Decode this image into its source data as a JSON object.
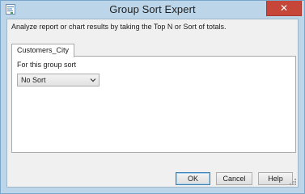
{
  "window": {
    "title": "Group Sort Expert",
    "close_symbol": "✕"
  },
  "description": "Analyze report or chart results by taking the Top N or Sort of totals.",
  "tabs": [
    {
      "label": "Customers_City",
      "selected": true
    }
  ],
  "group_sort": {
    "label": "For this group sort",
    "selected_option": "No Sort"
  },
  "buttons": {
    "ok": "OK",
    "cancel": "Cancel",
    "help": "Help"
  },
  "icons": {
    "app": "report-document-icon",
    "dropdown": "chevron-down-icon",
    "grip": "resize-grip-icon"
  },
  "colors": {
    "title_bar": "#bcd5e8",
    "close_button": "#c7463a",
    "dialog_body": "#f0f0f0",
    "default_button_border": "#3c7fb1"
  }
}
